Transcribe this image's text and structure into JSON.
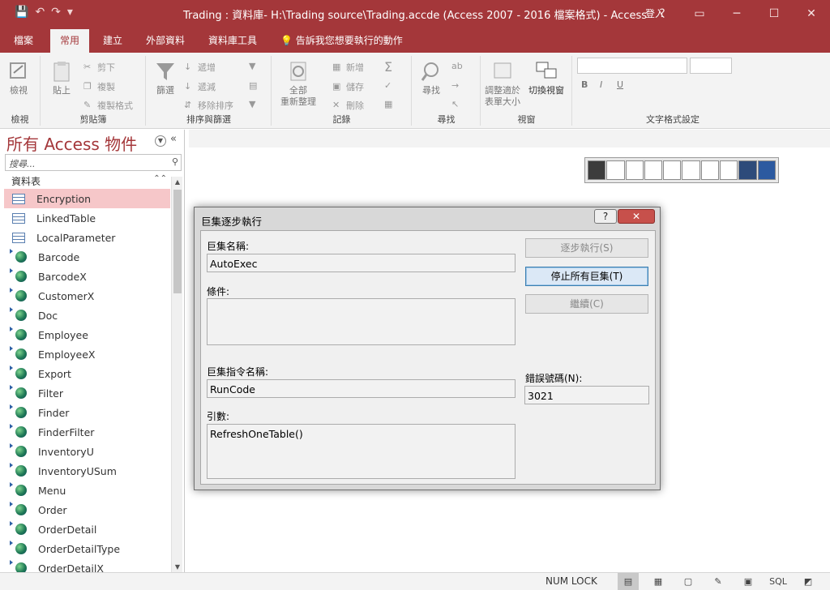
{
  "titlebar": {
    "title": "Trading : 資料庫- H:\\Trading source\\Trading.accde (Access 2007 - 2016 檔案格式) - Access",
    "signin": "登入",
    "help": "?",
    "restore_icon": "restore-icon",
    "qat": {
      "save": "💾",
      "undo": "↶",
      "redo": "↷",
      "customize": "▾"
    },
    "window": {
      "ribbon_display": "▭",
      "minimize": "─",
      "maximize": "☐",
      "close": "✕"
    }
  },
  "tabs": {
    "file": "檔案",
    "home": "常用",
    "create": "建立",
    "external": "外部資料",
    "dbtools": "資料庫工具",
    "tell": "告訴我您想要執行的動作"
  },
  "ribbon": {
    "views": {
      "view": "檢視",
      "label": "檢視"
    },
    "clipboard": {
      "paste": "貼上",
      "cut": "剪下",
      "copy": "複製",
      "format_painter": "複製格式",
      "label": "剪貼簿"
    },
    "sort": {
      "filter": "篩選",
      "ascending": "遞增",
      "descending": "遞減",
      "remove_sort": "移除排序",
      "label": "排序與篩選"
    },
    "records": {
      "refresh_all_1": "全部",
      "refresh_all_2": "重新整理",
      "new": "新增",
      "save": "儲存",
      "delete": "刪除",
      "label": "記錄"
    },
    "find": {
      "find": "尋找",
      "label": "尋找"
    },
    "window": {
      "fit_1": "調整適於",
      "fit_2": "表單大小",
      "switch": "切換視窗",
      "label": "視窗"
    },
    "text": {
      "bold": "B",
      "italic": "I",
      "underline": "U",
      "label": "文字格式設定"
    }
  },
  "nav": {
    "title": "所有 Access 物件",
    "search_placeholder": "搜尋...",
    "section": "資料表",
    "items": [
      {
        "label": "Encryption",
        "kind": "table",
        "selected": true
      },
      {
        "label": "LinkedTable",
        "kind": "table"
      },
      {
        "label": "LocalParameter",
        "kind": "table"
      },
      {
        "label": "Barcode",
        "kind": "linked"
      },
      {
        "label": "BarcodeX",
        "kind": "linked"
      },
      {
        "label": "CustomerX",
        "kind": "linked"
      },
      {
        "label": "Doc",
        "kind": "linked"
      },
      {
        "label": "Employee",
        "kind": "linked"
      },
      {
        "label": "EmployeeX",
        "kind": "linked"
      },
      {
        "label": "Export",
        "kind": "linked"
      },
      {
        "label": "Filter",
        "kind": "linked"
      },
      {
        "label": "Finder",
        "kind": "linked"
      },
      {
        "label": "FinderFilter",
        "kind": "linked"
      },
      {
        "label": "InventoryU",
        "kind": "linked"
      },
      {
        "label": "InventoryUSum",
        "kind": "linked"
      },
      {
        "label": "Menu",
        "kind": "linked"
      },
      {
        "label": "Order",
        "kind": "linked"
      },
      {
        "label": "OrderDetail",
        "kind": "linked"
      },
      {
        "label": "OrderDetailType",
        "kind": "linked"
      },
      {
        "label": "OrderDetailX",
        "kind": "linked"
      }
    ]
  },
  "dialog": {
    "title": "巨集逐步執行",
    "help": "?",
    "close": "✕",
    "macro_name_label": "巨集名稱:",
    "macro_name": "AutoExec",
    "condition_label": "條件:",
    "condition": "",
    "action_label": "巨集指令名稱:",
    "action": "RunCode",
    "args_label": "引數:",
    "args": "RefreshOneTable()",
    "error_label": "錯誤號碼(N):",
    "error_number": "3021",
    "btn_step": "逐步執行(S)",
    "btn_stop": "停止所有巨集(T)",
    "btn_continue": "繼續(C)"
  },
  "status": {
    "numlock": "NUM LOCK",
    "sql": "SQL"
  }
}
